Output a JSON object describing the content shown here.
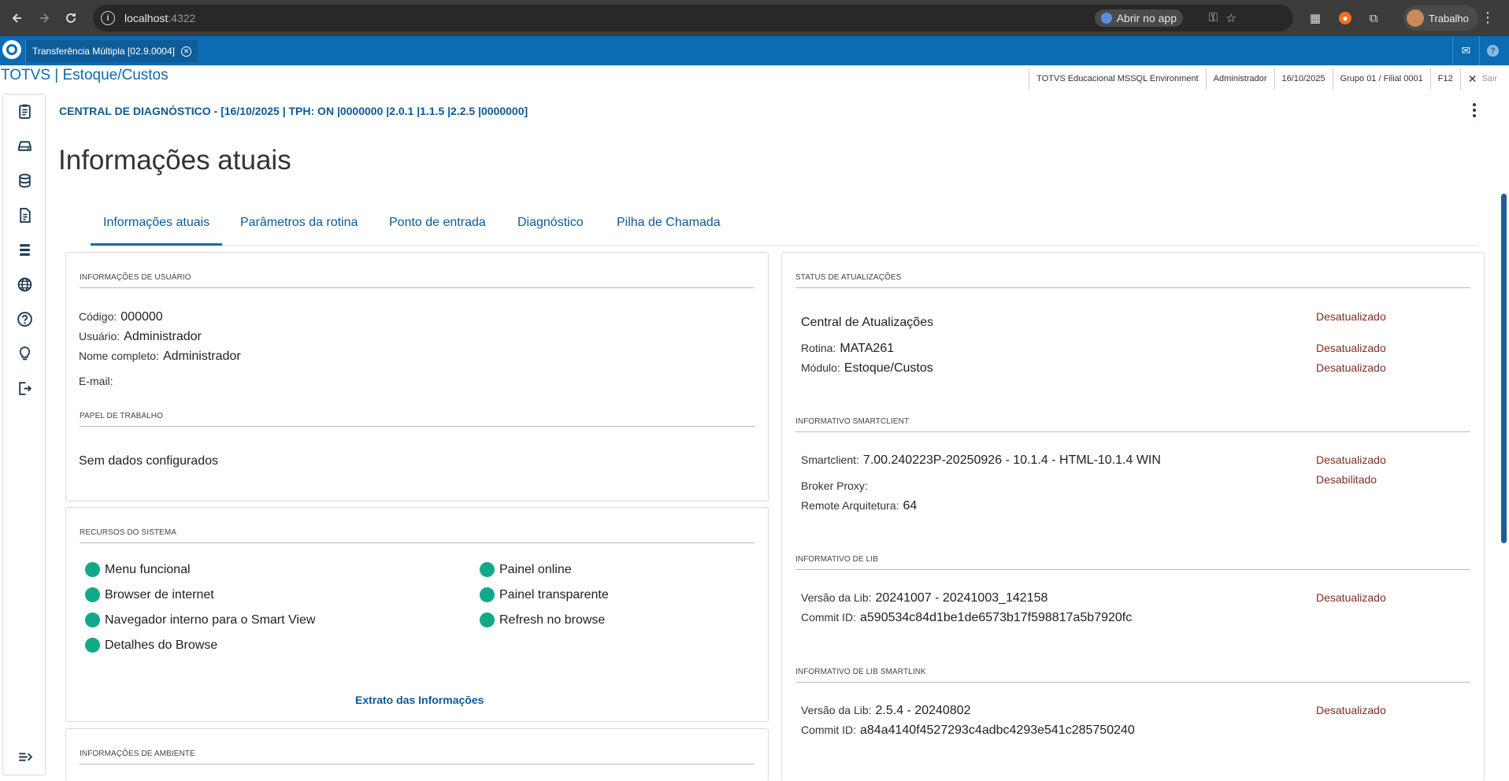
{
  "browser": {
    "url_host": "localhost",
    "url_port": ":4322",
    "open_app_label": "Abrir no app",
    "profile_label": "Trabalho"
  },
  "app": {
    "tab_title": "Transferência Múltipla [02.9.0004]",
    "brand": "TOTVS | Estoque/Custos",
    "status": {
      "environment": "TOTVS Educacional MSSQL Environment",
      "user": "Administrador",
      "date": "16/10/2025",
      "branch": "Grupo 01 / Filial 0001",
      "shortcut": "F12",
      "exit": "Sair"
    }
  },
  "header": {
    "diagnostic_title": "CENTRAL DE DIAGNÓSTICO - [16/10/2025 | TPH: ON |0000000 |2.0.1 |1.1.5 |2.2.5 |0000000]",
    "page_title": "Informações atuais"
  },
  "tabs": [
    {
      "label": "Informações atuais"
    },
    {
      "label": "Parâmetros da rotina"
    },
    {
      "label": "Ponto de entrada"
    },
    {
      "label": "Diagnóstico"
    },
    {
      "label": "Pilha de Chamada"
    }
  ],
  "user_info": {
    "title": "INFORMAÇÕES DE USUÁRIO",
    "code_label": "Código:",
    "code_value": "000000",
    "user_label": "Usuário:",
    "user_value": "Administrador",
    "fullname_label": "Nome completo:",
    "fullname_value": "Administrador",
    "email_label": "E-mail:"
  },
  "work_paper": {
    "title": "PAPEL DE TRABALHO",
    "empty_text": "Sem dados configurados"
  },
  "resources": {
    "title": "RECURSOS DO SISTEMA",
    "items": [
      {
        "label": "Menu funcional"
      },
      {
        "label": "Browser de internet"
      },
      {
        "label": "Navegador interno para o Smart View"
      },
      {
        "label": "Detalhes do Browse"
      },
      {
        "label": "Painel online"
      },
      {
        "label": "Painel transparente"
      },
      {
        "label": "Refresh no browse"
      }
    ],
    "link": "Extrato das Informações",
    "status_color": "#11a98a"
  },
  "env_info": {
    "title": "INFORMAÇÕES DE AMBIENTE"
  },
  "updates": {
    "title": "STATUS DE ATUALIZAÇÕES",
    "central_label": "Central de Atualizações",
    "central_status": "Desatualizado",
    "routine_label": "Rotina:",
    "routine_value": "MATA261",
    "routine_status": "Desatualizado",
    "module_label": "Módulo:",
    "module_value": "Estoque/Custos",
    "module_status": "Desatualizado"
  },
  "smartclient": {
    "title": "INFORMATIVO SMARTCLIENT",
    "sc_label": "Smartclient:",
    "sc_value": "7.00.240223P-20250926 - 10.1.4 - HTML-10.1.4 WIN",
    "sc_status": "Desatualizado",
    "broker_label": "Broker Proxy:",
    "broker_status": "Desabilitado",
    "arch_label": "Remote Arquitetura:",
    "arch_value": "64"
  },
  "lib": {
    "title": "INFORMATIVO DE LIB",
    "version_label": "Versão da Lib:",
    "version_value": "20241007 - 20241003_142158",
    "version_status": "Desatualizado",
    "commit_label": "Commit ID:",
    "commit_value": "a590534c84d1be1de6573b17f598817a5b7920fc"
  },
  "lib_smartlink": {
    "title": "INFORMATIVO DE LIB SMARTLINK",
    "version_label": "Versão da Lib:",
    "version_value": "2.5.4 - 20240802",
    "version_status": "Desatualizado",
    "commit_label": "Commit ID:",
    "commit_value": "a84a4140f4527293c4adbc4293e541c285750240"
  },
  "colors": {
    "brand_blue": "#0b6bb3",
    "warn_red": "#7d2e24",
    "ok_green": "#11a98a"
  }
}
